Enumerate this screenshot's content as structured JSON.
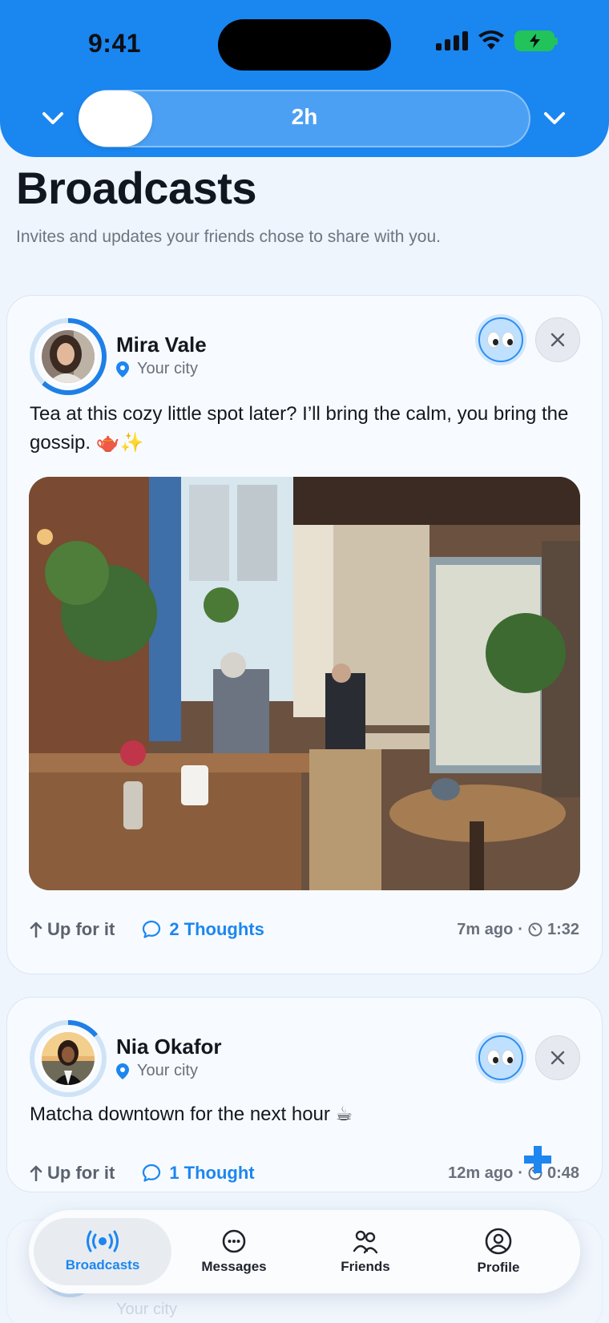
{
  "status_bar": {
    "time": "9:41"
  },
  "header": {
    "slider_value": "2h"
  },
  "page": {
    "title": "Broadcasts",
    "subtitle": "Invites and updates your friends chose to share with you."
  },
  "posts": [
    {
      "name": "Mira Vale",
      "location": "Your city",
      "text": "Tea at this cozy little spot later? I’ll bring the calm, you bring the gossip. 🫖✨",
      "up_for_it": "Up for it",
      "thoughts": "2 Thoughts",
      "time_ago": "7m ago",
      "separator": "·",
      "timer": "1:32"
    },
    {
      "name": "Nia Okafor",
      "location": "Your city",
      "text": "Matcha downtown for the next hour ☕",
      "up_for_it": "Up for it",
      "thoughts": "1 Thought",
      "time_ago": "12m ago",
      "separator": "·",
      "timer": "0:48"
    }
  ],
  "ghost_post": {
    "location": "Your city"
  },
  "tabs": [
    {
      "label": "Broadcasts",
      "icon": "broadcast-icon",
      "active": true
    },
    {
      "label": "Messages",
      "icon": "messages-icon",
      "active": false
    },
    {
      "label": "Friends",
      "icon": "friends-icon",
      "active": false
    },
    {
      "label": "Profile",
      "icon": "profile-icon",
      "active": false
    }
  ],
  "colors": {
    "accent": "#1a86f0",
    "battery": "#21c35a"
  }
}
